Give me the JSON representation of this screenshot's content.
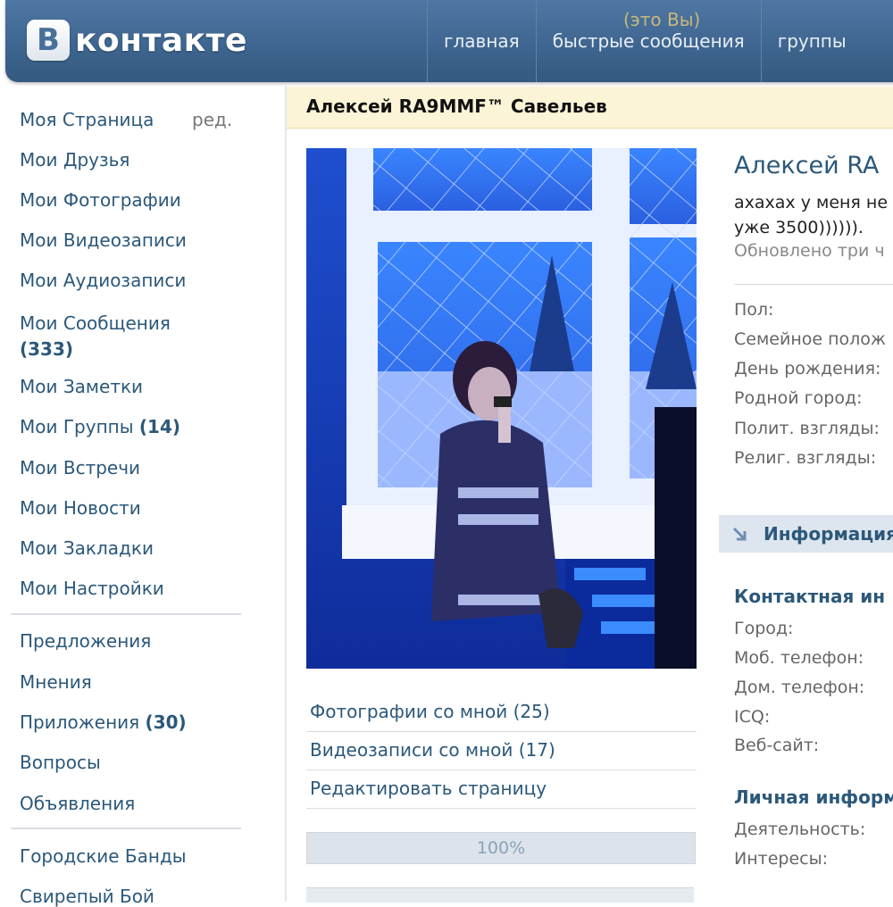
{
  "header": {
    "logo_letter": "В",
    "logo_text": "контакте",
    "nav": [
      "главная",
      "быстрые сообщения",
      "группы"
    ]
  },
  "sidebar": {
    "edit": "ред.",
    "items_a": [
      {
        "label": "Моя Страница"
      },
      {
        "label": "Мои Друзья"
      },
      {
        "label": "Мои Фотографии"
      },
      {
        "label": "Мои Видеозаписи"
      },
      {
        "label": "Мои Аудиозаписи"
      },
      {
        "label": "Мои Сообщения",
        "count": "(333)"
      },
      {
        "label": "Мои Заметки"
      },
      {
        "label": "Мои Группы",
        "count": "(14)"
      },
      {
        "label": "Мои Встречи"
      },
      {
        "label": "Мои Новости"
      },
      {
        "label": "Мои Закладки"
      },
      {
        "label": "Мои Настройки"
      }
    ],
    "items_b": [
      {
        "label": "Предложения"
      },
      {
        "label": "Мнения"
      },
      {
        "label": "Приложения",
        "count": "(30)"
      },
      {
        "label": "Вопросы"
      },
      {
        "label": "Объявления"
      }
    ],
    "items_c": [
      {
        "label": "Городские Банды"
      },
      {
        "label": "Свирепый Бой"
      }
    ]
  },
  "title_bar": {
    "name": "Алексей RA9MMF™ Савельев",
    "you": "(это Вы)"
  },
  "profile_links": [
    "Фотографии со мной (25)",
    "Видеозаписи со мной (17)",
    "Редактировать страницу"
  ],
  "progress": {
    "label": "100%",
    "fraction": 1.0
  },
  "info": {
    "name": "Алексей RA",
    "status_line1": "ахахах у меня не",
    "status_line2": "уже 3500)))))).",
    "updated": "Обновлено три ч",
    "fields": [
      "Пол:",
      "Семейное полож",
      "День рождения:",
      "Родной город:",
      "Полит. взгляды:",
      "Религ. взгляды:"
    ],
    "section_title": "Информация",
    "contact_title": "Контактная ин",
    "contact_fields": [
      "Город:",
      "Моб. телефон:",
      "Дом. телефон:",
      "ICQ:",
      "Веб-сайт:"
    ],
    "personal_title": "Личная информ",
    "personal_fields": [
      "Деятельность:",
      "Интересы:"
    ]
  },
  "colors": {
    "header": "#3e6690",
    "link": "#2b587a",
    "title_bar_bg": "#fcf4d6",
    "section_bar_bg": "#dde5ee"
  }
}
